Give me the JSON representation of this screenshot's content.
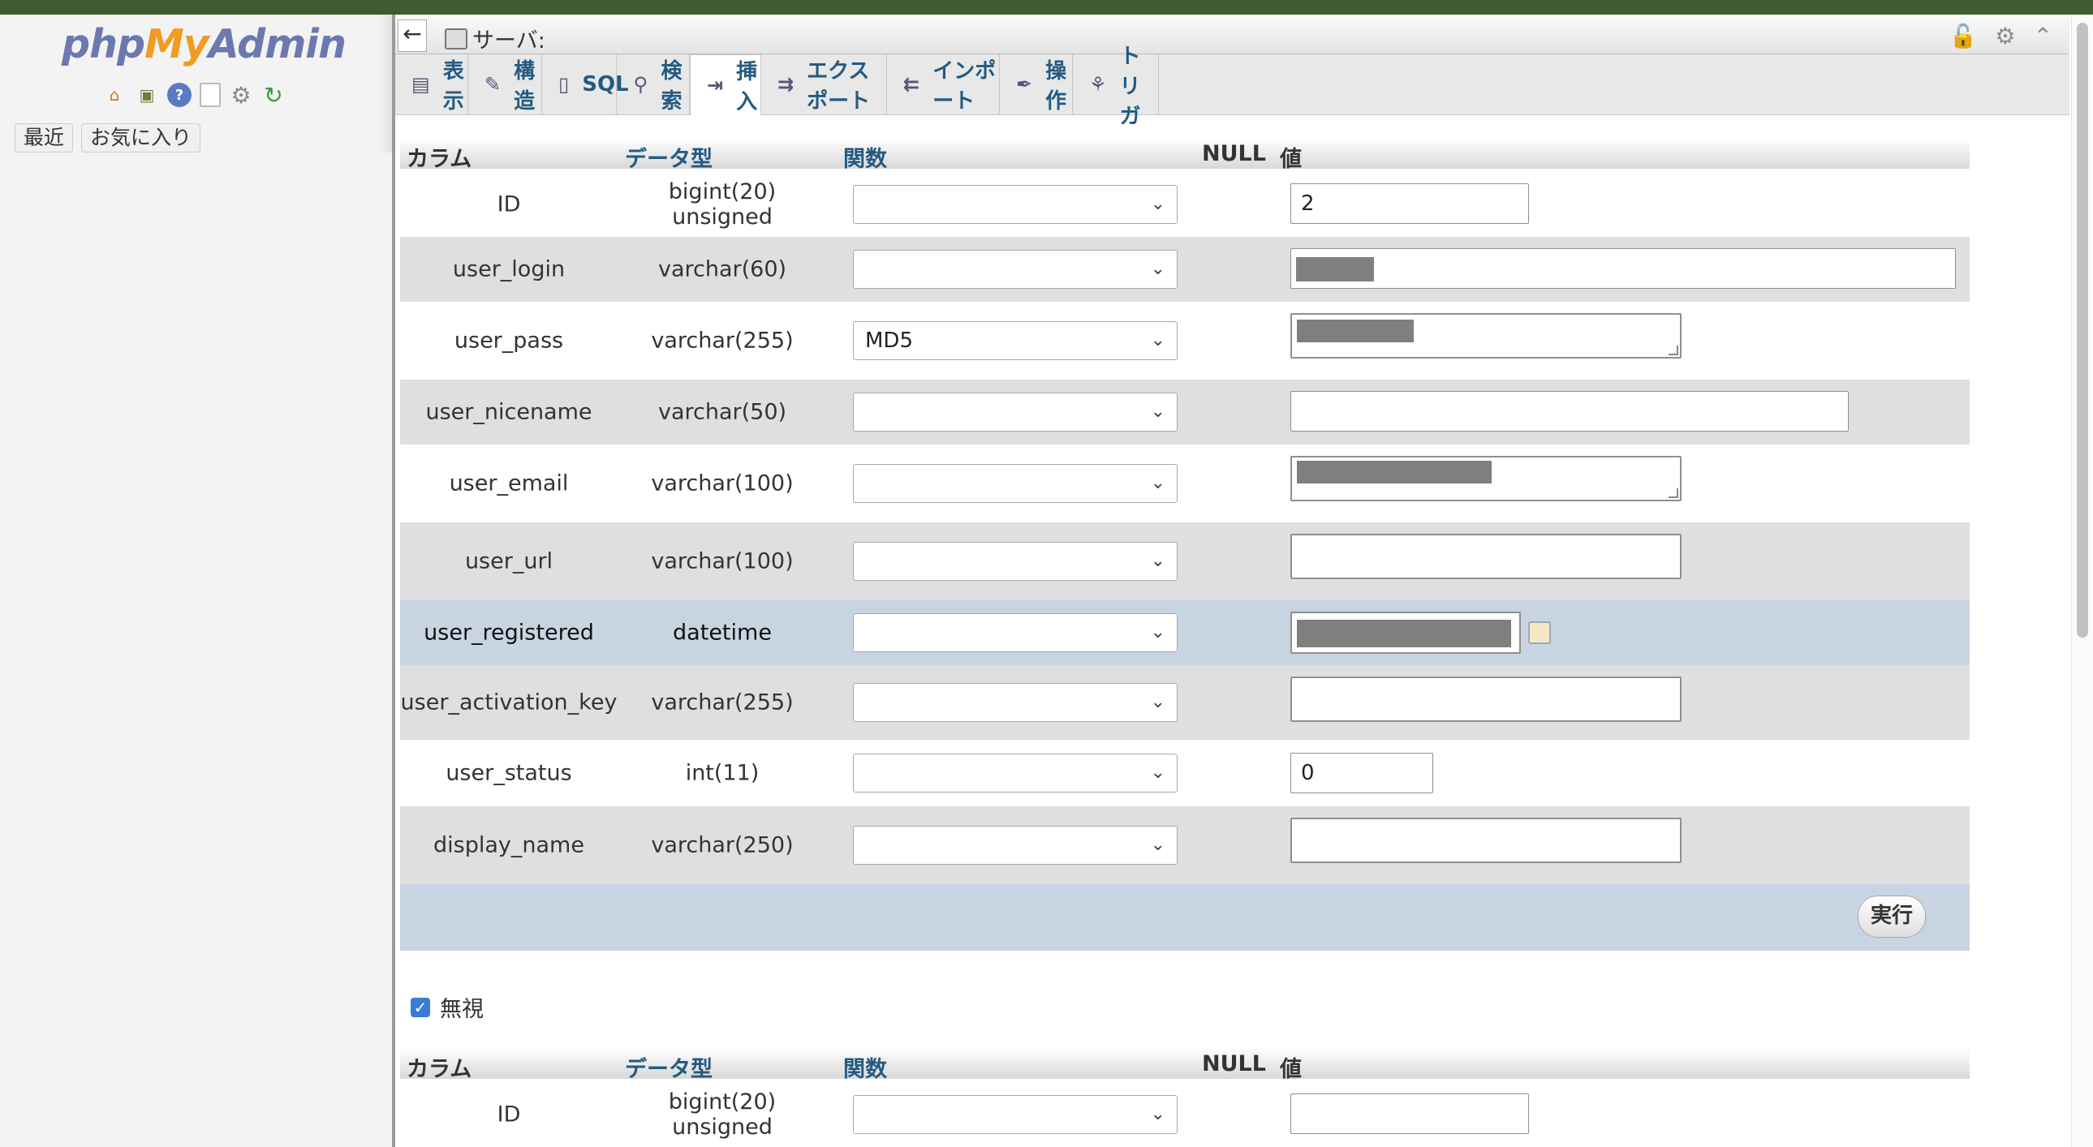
{
  "app": {
    "logo": {
      "part1": "php",
      "part2": "My",
      "part3": "Admin"
    },
    "left_buttons": {
      "recent": "最近",
      "favorites": "お気に入り"
    },
    "nav_icons": [
      "home-icon",
      "database-icon",
      "help-icon",
      "docs-icon",
      "settings-icon",
      "reload-icon"
    ]
  },
  "breadcrumb": {
    "back": "←",
    "server": "サーバ:"
  },
  "tabs": [
    {
      "label": "表示",
      "icon": "browse-icon"
    },
    {
      "label": "構造",
      "icon": "structure-icon"
    },
    {
      "label": "SQL",
      "icon": "sql-icon"
    },
    {
      "label": "検索",
      "icon": "search-icon"
    },
    {
      "label": "挿入",
      "icon": "insert-icon",
      "active": true
    },
    {
      "label": "エクスポート",
      "icon": "export-icon"
    },
    {
      "label": "インポート",
      "icon": "import-icon"
    },
    {
      "label": "操作",
      "icon": "operations-icon"
    },
    {
      "label": "トリガ",
      "icon": "triggers-icon"
    }
  ],
  "table": {
    "headers": {
      "column": "カラム",
      "type": "データ型",
      "function": "関数",
      "null": "NULL",
      "value": "値"
    },
    "rows": [
      {
        "name": "ID",
        "type": "bigint(20) unsigned",
        "func": "",
        "value": "2"
      },
      {
        "name": "user_login",
        "type": "varchar(60)",
        "func": "",
        "value": ""
      },
      {
        "name": "user_pass",
        "type": "varchar(255)",
        "func": "MD5",
        "value": ""
      },
      {
        "name": "user_nicename",
        "type": "varchar(50)",
        "func": "",
        "value": ""
      },
      {
        "name": "user_email",
        "type": "varchar(100)",
        "func": "",
        "value": ""
      },
      {
        "name": "user_url",
        "type": "varchar(100)",
        "func": "",
        "value": ""
      },
      {
        "name": "user_registered",
        "type": "datetime",
        "func": "",
        "value": ""
      },
      {
        "name": "user_activation_key",
        "type": "varchar(255)",
        "func": "",
        "value": ""
      },
      {
        "name": "user_status",
        "type": "int(11)",
        "func": "",
        "value": "0"
      },
      {
        "name": "display_name",
        "type": "varchar(250)",
        "func": "",
        "value": ""
      }
    ],
    "execute": "実行"
  },
  "ignore": {
    "label": "無視",
    "checked": true
  },
  "table2": {
    "headers": {
      "column": "カラム",
      "type": "データ型",
      "function": "関数",
      "null": "NULL",
      "value": "値"
    },
    "rows": [
      {
        "name": "ID",
        "type": "bigint(20) unsigned",
        "func": "",
        "value": ""
      }
    ]
  }
}
